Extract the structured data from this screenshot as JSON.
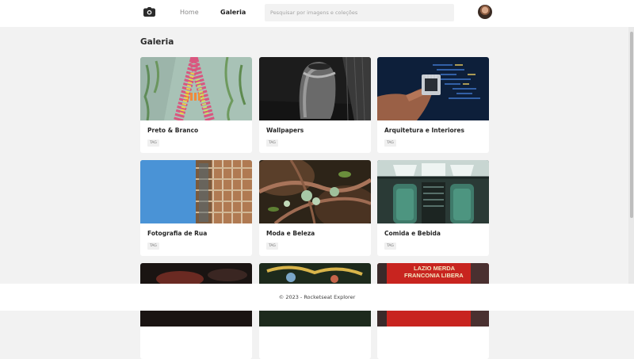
{
  "header": {
    "logo_icon": "camera-icon",
    "nav": [
      {
        "label": "Home"
      },
      {
        "label": "Galeria"
      }
    ],
    "search": {
      "placeholder": "Pesquisar por imagens e coleções",
      "value": ""
    },
    "avatar_icon": "user-avatar"
  },
  "main": {
    "title": "Galeria",
    "cards": [
      {
        "title": "Preto & Branco",
        "tag": "TAG"
      },
      {
        "title": "Wallpapers",
        "tag": "TAG"
      },
      {
        "title": "Arquitetura e Interiores",
        "tag": "TAG"
      },
      {
        "title": "Fotografia de Rua",
        "tag": "TAG"
      },
      {
        "title": "Moda e Beleza",
        "tag": "TAG"
      },
      {
        "title": "Comida e Bebida",
        "tag": "TAG"
      }
    ],
    "partial_card_sign": {
      "line1": "LAZIO MERDA",
      "line2": "FRANCONIA LIBERA"
    }
  },
  "footer": {
    "text": "© 2023 - Rocketseat Explorer"
  },
  "colors": {
    "background": "#f2f2f2",
    "surface": "#ffffff",
    "text": "#262626",
    "muted": "#8a8a8a"
  }
}
